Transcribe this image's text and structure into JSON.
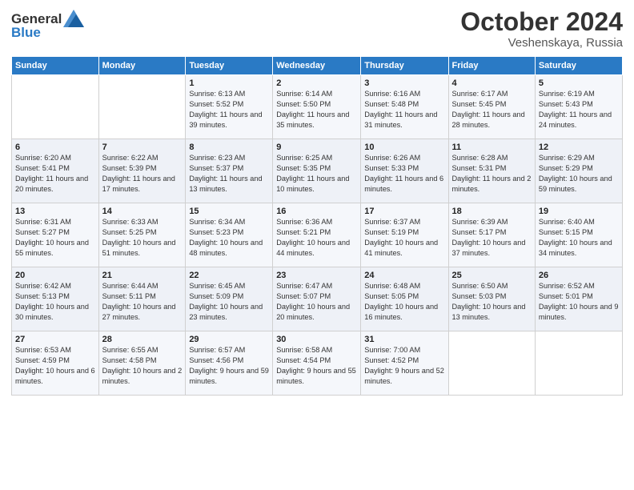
{
  "logo": {
    "text_general": "General",
    "text_blue": "Blue"
  },
  "title": "October 2024",
  "location": "Veshenskaya, Russia",
  "weekdays": [
    "Sunday",
    "Monday",
    "Tuesday",
    "Wednesday",
    "Thursday",
    "Friday",
    "Saturday"
  ],
  "weeks": [
    [
      {
        "day": "",
        "sunrise": "",
        "sunset": "",
        "daylight": ""
      },
      {
        "day": "",
        "sunrise": "",
        "sunset": "",
        "daylight": ""
      },
      {
        "day": "1",
        "sunrise": "Sunrise: 6:13 AM",
        "sunset": "Sunset: 5:52 PM",
        "daylight": "Daylight: 11 hours and 39 minutes."
      },
      {
        "day": "2",
        "sunrise": "Sunrise: 6:14 AM",
        "sunset": "Sunset: 5:50 PM",
        "daylight": "Daylight: 11 hours and 35 minutes."
      },
      {
        "day": "3",
        "sunrise": "Sunrise: 6:16 AM",
        "sunset": "Sunset: 5:48 PM",
        "daylight": "Daylight: 11 hours and 31 minutes."
      },
      {
        "day": "4",
        "sunrise": "Sunrise: 6:17 AM",
        "sunset": "Sunset: 5:45 PM",
        "daylight": "Daylight: 11 hours and 28 minutes."
      },
      {
        "day": "5",
        "sunrise": "Sunrise: 6:19 AM",
        "sunset": "Sunset: 5:43 PM",
        "daylight": "Daylight: 11 hours and 24 minutes."
      }
    ],
    [
      {
        "day": "6",
        "sunrise": "Sunrise: 6:20 AM",
        "sunset": "Sunset: 5:41 PM",
        "daylight": "Daylight: 11 hours and 20 minutes."
      },
      {
        "day": "7",
        "sunrise": "Sunrise: 6:22 AM",
        "sunset": "Sunset: 5:39 PM",
        "daylight": "Daylight: 11 hours and 17 minutes."
      },
      {
        "day": "8",
        "sunrise": "Sunrise: 6:23 AM",
        "sunset": "Sunset: 5:37 PM",
        "daylight": "Daylight: 11 hours and 13 minutes."
      },
      {
        "day": "9",
        "sunrise": "Sunrise: 6:25 AM",
        "sunset": "Sunset: 5:35 PM",
        "daylight": "Daylight: 11 hours and 10 minutes."
      },
      {
        "day": "10",
        "sunrise": "Sunrise: 6:26 AM",
        "sunset": "Sunset: 5:33 PM",
        "daylight": "Daylight: 11 hours and 6 minutes."
      },
      {
        "day": "11",
        "sunrise": "Sunrise: 6:28 AM",
        "sunset": "Sunset: 5:31 PM",
        "daylight": "Daylight: 11 hours and 2 minutes."
      },
      {
        "day": "12",
        "sunrise": "Sunrise: 6:29 AM",
        "sunset": "Sunset: 5:29 PM",
        "daylight": "Daylight: 10 hours and 59 minutes."
      }
    ],
    [
      {
        "day": "13",
        "sunrise": "Sunrise: 6:31 AM",
        "sunset": "Sunset: 5:27 PM",
        "daylight": "Daylight: 10 hours and 55 minutes."
      },
      {
        "day": "14",
        "sunrise": "Sunrise: 6:33 AM",
        "sunset": "Sunset: 5:25 PM",
        "daylight": "Daylight: 10 hours and 51 minutes."
      },
      {
        "day": "15",
        "sunrise": "Sunrise: 6:34 AM",
        "sunset": "Sunset: 5:23 PM",
        "daylight": "Daylight: 10 hours and 48 minutes."
      },
      {
        "day": "16",
        "sunrise": "Sunrise: 6:36 AM",
        "sunset": "Sunset: 5:21 PM",
        "daylight": "Daylight: 10 hours and 44 minutes."
      },
      {
        "day": "17",
        "sunrise": "Sunrise: 6:37 AM",
        "sunset": "Sunset: 5:19 PM",
        "daylight": "Daylight: 10 hours and 41 minutes."
      },
      {
        "day": "18",
        "sunrise": "Sunrise: 6:39 AM",
        "sunset": "Sunset: 5:17 PM",
        "daylight": "Daylight: 10 hours and 37 minutes."
      },
      {
        "day": "19",
        "sunrise": "Sunrise: 6:40 AM",
        "sunset": "Sunset: 5:15 PM",
        "daylight": "Daylight: 10 hours and 34 minutes."
      }
    ],
    [
      {
        "day": "20",
        "sunrise": "Sunrise: 6:42 AM",
        "sunset": "Sunset: 5:13 PM",
        "daylight": "Daylight: 10 hours and 30 minutes."
      },
      {
        "day": "21",
        "sunrise": "Sunrise: 6:44 AM",
        "sunset": "Sunset: 5:11 PM",
        "daylight": "Daylight: 10 hours and 27 minutes."
      },
      {
        "day": "22",
        "sunrise": "Sunrise: 6:45 AM",
        "sunset": "Sunset: 5:09 PM",
        "daylight": "Daylight: 10 hours and 23 minutes."
      },
      {
        "day": "23",
        "sunrise": "Sunrise: 6:47 AM",
        "sunset": "Sunset: 5:07 PM",
        "daylight": "Daylight: 10 hours and 20 minutes."
      },
      {
        "day": "24",
        "sunrise": "Sunrise: 6:48 AM",
        "sunset": "Sunset: 5:05 PM",
        "daylight": "Daylight: 10 hours and 16 minutes."
      },
      {
        "day": "25",
        "sunrise": "Sunrise: 6:50 AM",
        "sunset": "Sunset: 5:03 PM",
        "daylight": "Daylight: 10 hours and 13 minutes."
      },
      {
        "day": "26",
        "sunrise": "Sunrise: 6:52 AM",
        "sunset": "Sunset: 5:01 PM",
        "daylight": "Daylight: 10 hours and 9 minutes."
      }
    ],
    [
      {
        "day": "27",
        "sunrise": "Sunrise: 6:53 AM",
        "sunset": "Sunset: 4:59 PM",
        "daylight": "Daylight: 10 hours and 6 minutes."
      },
      {
        "day": "28",
        "sunrise": "Sunrise: 6:55 AM",
        "sunset": "Sunset: 4:58 PM",
        "daylight": "Daylight: 10 hours and 2 minutes."
      },
      {
        "day": "29",
        "sunrise": "Sunrise: 6:57 AM",
        "sunset": "Sunset: 4:56 PM",
        "daylight": "Daylight: 9 hours and 59 minutes."
      },
      {
        "day": "30",
        "sunrise": "Sunrise: 6:58 AM",
        "sunset": "Sunset: 4:54 PM",
        "daylight": "Daylight: 9 hours and 55 minutes."
      },
      {
        "day": "31",
        "sunrise": "Sunrise: 7:00 AM",
        "sunset": "Sunset: 4:52 PM",
        "daylight": "Daylight: 9 hours and 52 minutes."
      },
      {
        "day": "",
        "sunrise": "",
        "sunset": "",
        "daylight": ""
      },
      {
        "day": "",
        "sunrise": "",
        "sunset": "",
        "daylight": ""
      }
    ]
  ]
}
